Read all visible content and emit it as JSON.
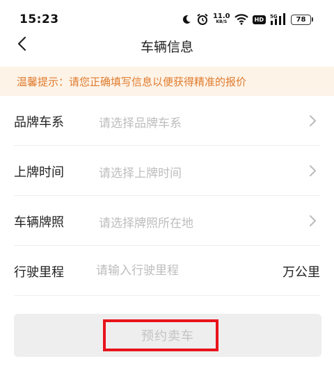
{
  "status_bar": {
    "time": "15:23",
    "net_speed_value": "11.0",
    "net_speed_unit": "KB/S",
    "hd_label": "HD",
    "signal_label": "5G",
    "battery": "78"
  },
  "nav": {
    "title": "车辆信息"
  },
  "tip": {
    "text": "温馨提示：请您正确填写信息以便获得精准的报价"
  },
  "form": {
    "rows": [
      {
        "label": "品牌车系",
        "placeholder": "请选择品牌车系"
      },
      {
        "label": "上牌时间",
        "placeholder": "请选择上牌时间"
      },
      {
        "label": "车辆牌照",
        "placeholder": "请选择牌照所在地"
      }
    ],
    "mileage": {
      "label": "行驶里程",
      "placeholder": "请输入行驶里程",
      "unit": "万公里"
    }
  },
  "submit": {
    "label": "预约卖车"
  },
  "colors": {
    "tip_bg": "#fdf3e7",
    "tip_text": "#e07b2e",
    "highlight": "#e8131b",
    "button_bg": "#eeeeee"
  }
}
